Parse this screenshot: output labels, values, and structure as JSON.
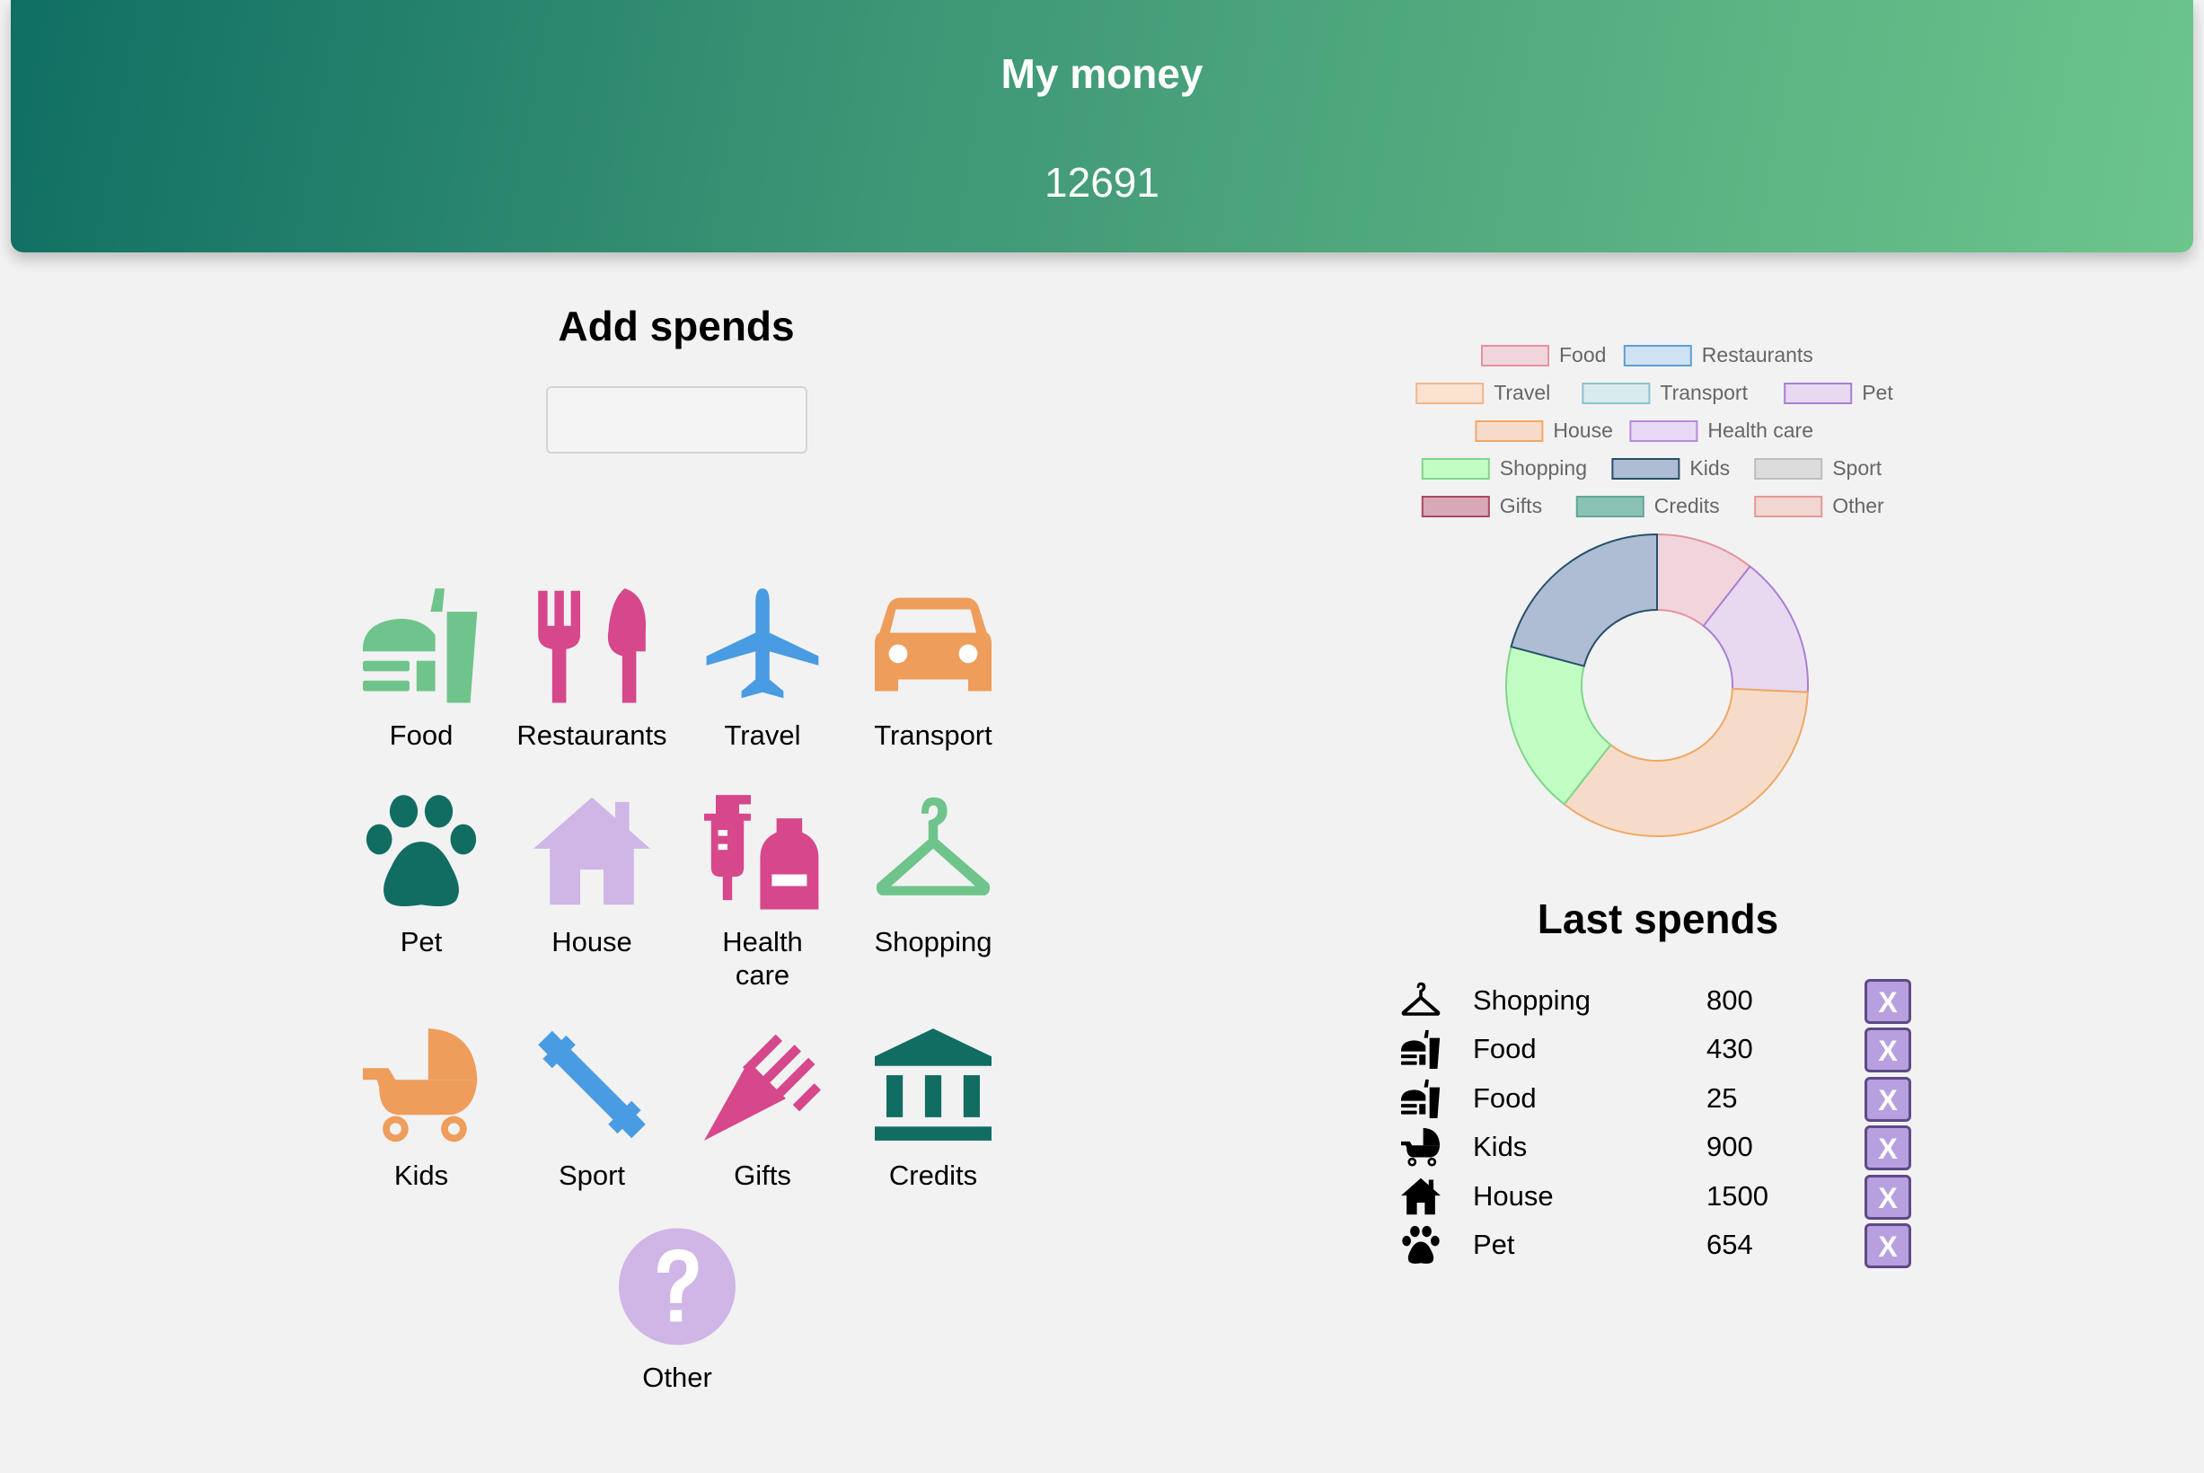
{
  "header": {
    "title": "My money",
    "balance": "12691"
  },
  "add_spends": {
    "title": "Add spends",
    "amount_value": "",
    "amount_placeholder": ""
  },
  "categories": [
    {
      "label": "Food",
      "icon": "food-icon",
      "color": "#6fc48b"
    },
    {
      "label": "Restaurants",
      "icon": "restaurant-icon",
      "color": "#d6488b"
    },
    {
      "label": "Travel",
      "icon": "airplane-icon",
      "color": "#4a9ce2"
    },
    {
      "label": "Transport",
      "icon": "car-icon",
      "color": "#ee9d5b"
    },
    {
      "label": "Pet",
      "icon": "paw-icon",
      "color": "#116d62"
    },
    {
      "label": "House",
      "icon": "house-icon",
      "color": "#cfb6e6"
    },
    {
      "label": "Health care",
      "icon": "medicine-icon",
      "color": "#d6488b"
    },
    {
      "label": "Shopping",
      "icon": "hanger-icon",
      "color": "#6fc48b"
    },
    {
      "label": "Kids",
      "icon": "stroller-icon",
      "color": "#ee9d5b"
    },
    {
      "label": "Sport",
      "icon": "dumbbell-icon",
      "color": "#4a9ce2"
    },
    {
      "label": "Gifts",
      "icon": "confetti-icon",
      "color": "#d6488b"
    },
    {
      "label": "Credits",
      "icon": "bank-icon",
      "color": "#116d62"
    },
    {
      "label": "Other",
      "icon": "question-icon",
      "color": "#cfb6e6"
    }
  ],
  "chart_data": {
    "type": "pie",
    "variant": "doughnut",
    "legend_position": "top",
    "categories": [
      "Food",
      "Restaurants",
      "Travel",
      "Transport",
      "Pet",
      "House",
      "Health care",
      "Shopping",
      "Kids",
      "Sport",
      "Gifts",
      "Credits",
      "Other"
    ],
    "values": [
      455,
      0,
      0,
      0,
      654,
      1500,
      0,
      800,
      900,
      0,
      0,
      0,
      0
    ],
    "fill_colors": [
      "#f0d6dc",
      "#cfe2f3",
      "#fbe2d0",
      "#d8ebee",
      "#e8d8f0",
      "#f6dcc8",
      "#ead9f4",
      "#c2fec4",
      "#aebdd4",
      "#dcdcdc",
      "#d8a8b6",
      "#8cc2b6",
      "#f2d6d2"
    ],
    "border_colors": [
      "#e8909e",
      "#5ba0d8",
      "#f2b58c",
      "#8fc2cc",
      "#a97fd6",
      "#f0a866",
      "#b68ad8",
      "#7ed68a",
      "#25506a",
      "#bdbdbd",
      "#a8485e",
      "#5fa898",
      "#e39a94"
    ]
  },
  "last_spends": {
    "title": "Last spends",
    "delete_label": "X",
    "items": [
      {
        "category": "Shopping",
        "amount": "800",
        "icon": "hanger-icon"
      },
      {
        "category": "Food",
        "amount": "430",
        "icon": "food-icon"
      },
      {
        "category": "Food",
        "amount": "25",
        "icon": "food-icon"
      },
      {
        "category": "Kids",
        "amount": "900",
        "icon": "stroller-icon"
      },
      {
        "category": "House",
        "amount": "1500",
        "icon": "house-icon"
      },
      {
        "category": "Pet",
        "amount": "654",
        "icon": "paw-icon"
      }
    ]
  }
}
